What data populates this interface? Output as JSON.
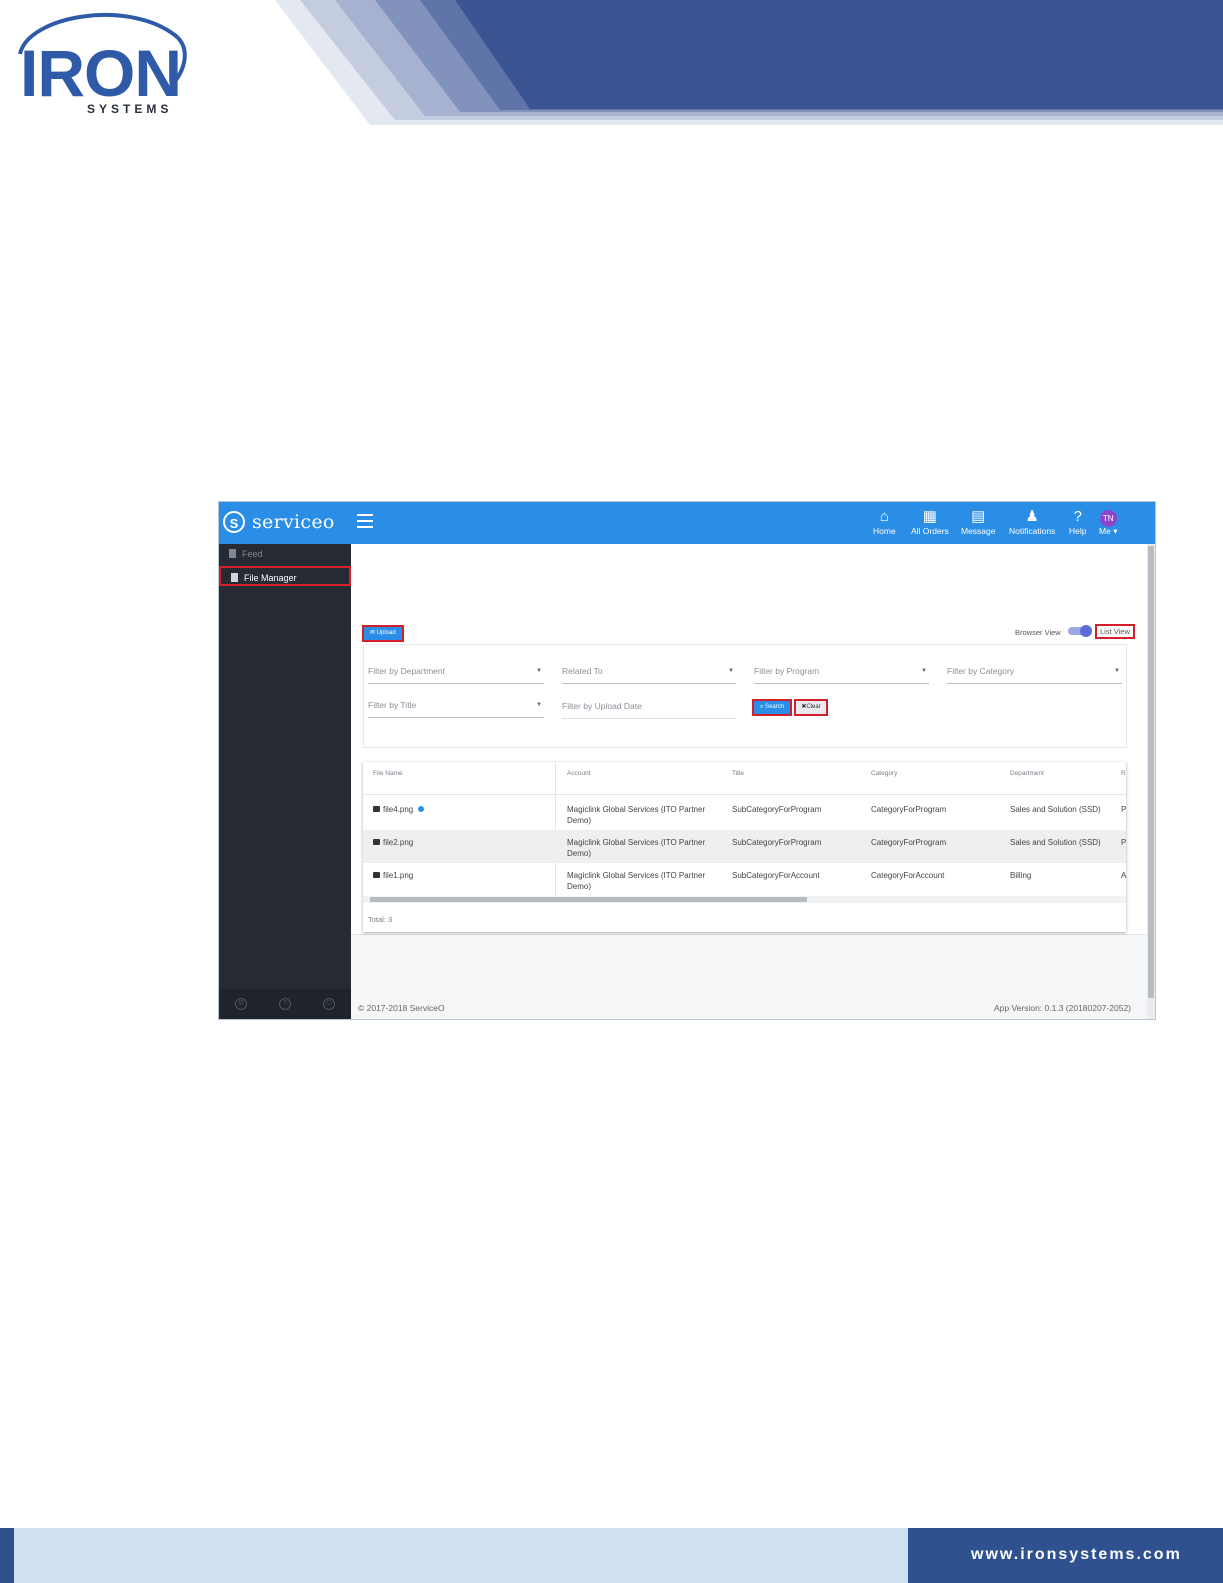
{
  "document": {
    "logo_main": "IRON",
    "logo_sub": "SYSTEMS",
    "footer_url": "www.ironsystems.com"
  },
  "app": {
    "brand": "serviceo",
    "nav": [
      {
        "label": "Home",
        "icon": "home-icon"
      },
      {
        "label": "All Orders",
        "icon": "orders-icon"
      },
      {
        "label": "Message",
        "icon": "message-icon"
      },
      {
        "label": "Notifications",
        "icon": "bell-icon"
      },
      {
        "label": "Help",
        "icon": "help-icon"
      },
      {
        "label": "Me",
        "icon": "avatar",
        "initials": "TN"
      }
    ],
    "sidebar": {
      "items": [
        {
          "label": "Feed"
        },
        {
          "label": "File Manager"
        }
      ]
    },
    "toolbar": {
      "upload": "Upload",
      "browser_view": "Browser View",
      "list_view": "List View"
    },
    "filters": {
      "department": "Filter by Department",
      "related": "Related To",
      "program": "Filter by Program",
      "category": "Filter by Category",
      "title": "Filter by Title",
      "upload_date": "Filter by Upload Date",
      "search": "Search",
      "clear": "Clear"
    },
    "table": {
      "columns": [
        "File Name",
        "Account",
        "Title",
        "Category",
        "Department",
        "R"
      ],
      "rows": [
        {
          "file": "file4.png",
          "account": "Magiclink Global Services (ITO Partner Demo)",
          "title": "SubCategoryForProgram",
          "category": "CategoryForProgram",
          "department": "Sales and Solution (SSD)",
          "extra": "P"
        },
        {
          "file": "file2.png",
          "account": "Magiclink Global Services (ITO Partner Demo)",
          "title": "SubCategoryForProgram",
          "category": "CategoryForProgram",
          "department": "Sales and Solution (SSD)",
          "extra": "P"
        },
        {
          "file": "file1.png",
          "account": "Magiclink Global Services (ITO Partner Demo)",
          "title": "SubCategoryForAccount",
          "category": "CategoryForAccount",
          "department": "Billing",
          "extra": "A"
        }
      ],
      "total": "Total: 3"
    },
    "footer": {
      "copyright": "© 2017-2018 ServiceO",
      "version": "App Version: 0.1.3 (20180207-2052)"
    },
    "colors": {
      "topbar": "#2a8de6",
      "sidebar": "#262b33",
      "highlight": "#d21f2b",
      "avatar": "#8e44c9"
    }
  }
}
